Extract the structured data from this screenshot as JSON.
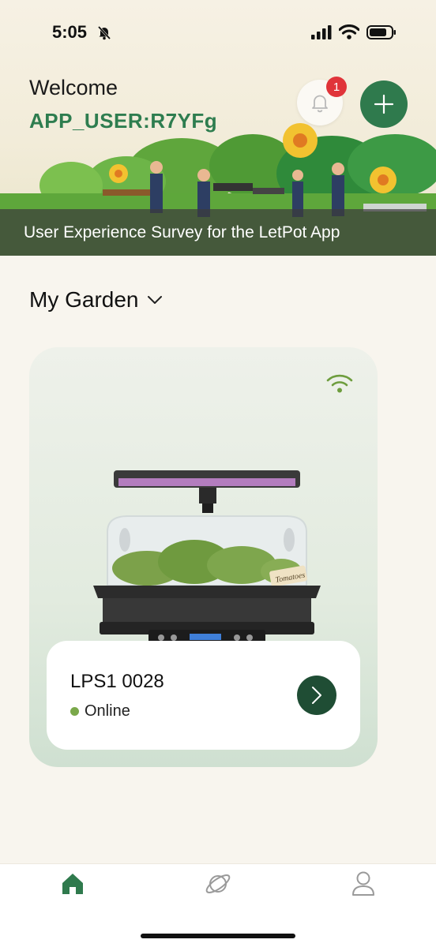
{
  "status_bar": {
    "time": "5:05"
  },
  "header": {
    "welcome": "Welcome",
    "username": "APP_USER:R7YFg",
    "notification_count": "1"
  },
  "banner": {
    "text": "User Experience Survey for the LetPot App"
  },
  "garden": {
    "title": "My Garden",
    "device": {
      "name": "LPS1 0028",
      "status": "Online",
      "label_tag": "Tomatoes"
    }
  },
  "tabs": [
    {
      "name": "home",
      "icon": "home-icon",
      "active": true
    },
    {
      "name": "explore",
      "icon": "planet-icon",
      "active": false
    },
    {
      "name": "profile",
      "icon": "user-icon",
      "active": false
    }
  ],
  "colors": {
    "brand_green": "#2f7a4d",
    "dark_green": "#1f4d34",
    "badge_red": "#e0343a",
    "online_dot": "#7aa84a"
  }
}
